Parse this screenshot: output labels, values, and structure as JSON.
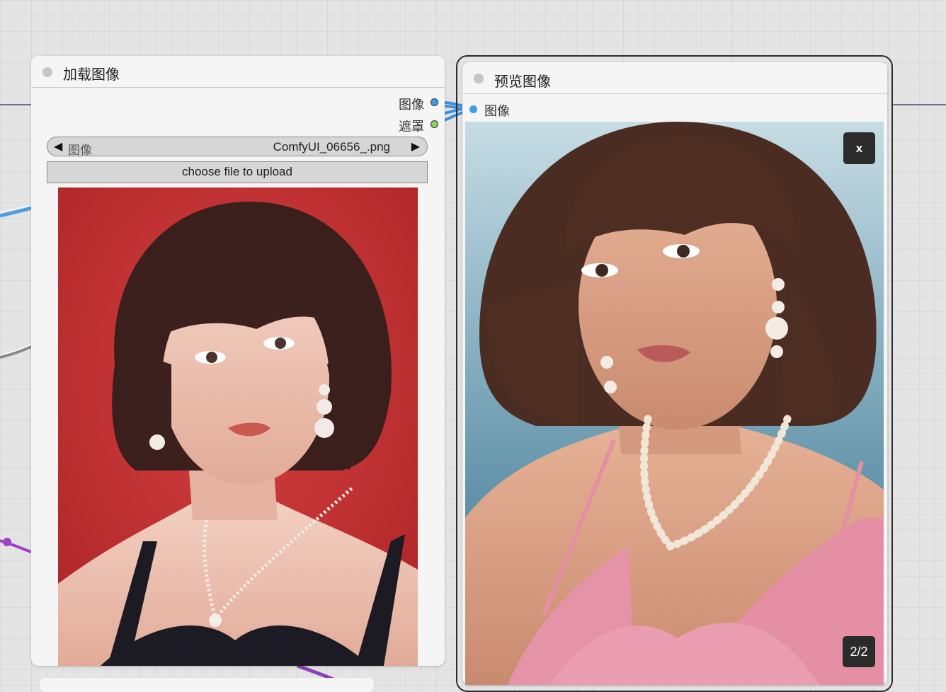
{
  "load_image_node": {
    "title": "加载图像",
    "outputs": [
      {
        "label": "图像",
        "port_color": "#3d9be9"
      },
      {
        "label": "遮罩",
        "port_color": "#8fce5c"
      }
    ],
    "image_combo": {
      "label": "图像",
      "value": "ComfyUI_06656_.png",
      "prev_icon": "◀",
      "next_icon": "▶"
    },
    "upload_button": "choose file to upload",
    "preview_image": "portrait-woman-red-background"
  },
  "preview_image_node": {
    "title": "预览图像",
    "input": {
      "label": "图像",
      "port_color": "#3d9be9"
    },
    "close_button": "x",
    "image_counter": "2/2",
    "preview_image": "portrait-woman-pink-top-seaside"
  }
}
